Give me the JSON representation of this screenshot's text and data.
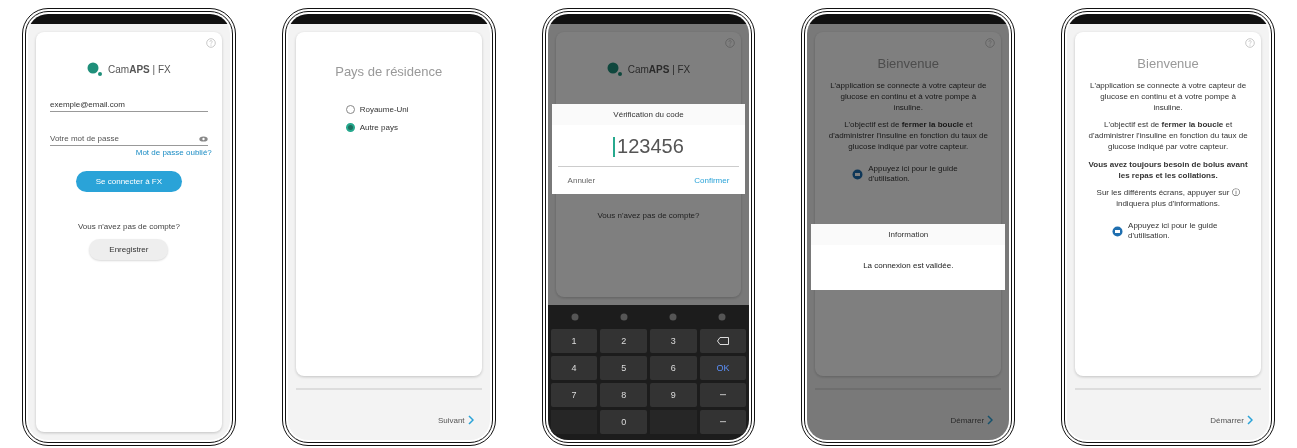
{
  "screens": [
    {
      "kind": "login",
      "logo": "Cam**APS** | FX",
      "email": {
        "value": "exemple@email.com"
      },
      "password": {
        "placeholder": "Votre mot de passe"
      },
      "forgot": "Mot de passe oublié?",
      "login_button": "Se connecter à FX",
      "no_account": "Vous n'avez pas de compte?",
      "register_button": "Enregistrer"
    },
    {
      "kind": "country",
      "title": "Pays de résidence",
      "options": [
        {
          "label": "Royaume-Uni",
          "selected": false
        },
        {
          "label": "Autre pays",
          "selected": true
        }
      ],
      "next": "Suivant"
    },
    {
      "kind": "code",
      "dimmed": true,
      "logo": "Cam**APS** | FX",
      "no_account": "Vous n'avez pas de compte?",
      "dialog": {
        "title": "Vérification du code",
        "value": "123456",
        "cancel": "Annuler",
        "confirm": "Confirmer"
      },
      "keys": [
        {
          "kind": "text",
          "label": "1"
        },
        {
          "kind": "text",
          "label": "2"
        },
        {
          "kind": "text",
          "label": "3"
        },
        {
          "kind": "backspace"
        },
        {
          "kind": "text",
          "label": "4"
        },
        {
          "kind": "text",
          "label": "5"
        },
        {
          "kind": "text",
          "label": "6"
        },
        {
          "kind": "ok",
          "label": "OK"
        },
        {
          "kind": "text",
          "label": "7"
        },
        {
          "kind": "text",
          "label": "8"
        },
        {
          "kind": "text",
          "label": "9"
        },
        {
          "kind": "symbol"
        },
        {
          "kind": "blank"
        },
        {
          "kind": "text",
          "label": "0"
        },
        {
          "kind": "blank"
        },
        {
          "kind": "symbol"
        }
      ]
    },
    {
      "kind": "welcome",
      "dimmed": true,
      "title": "Bienvenue",
      "paragraphs": [
        "L'application se connecte à votre capteur de glucose en continu et à votre pompe à insuline.",
        "L'objectif est de **fermer la boucle** et d'administrer l'insuline en fonction du taux de glucose indiqué par votre capteur."
      ],
      "guide": "Appuyez ici pour le guide d'utilisation.",
      "start": "Démarrer",
      "dialog": {
        "title": "Information",
        "message": "La connexion est validée."
      }
    },
    {
      "kind": "welcome",
      "title": "Bienvenue",
      "paragraphs": [
        "L'application se connecte à votre capteur de glucose en continu et à votre pompe à insuline.",
        "L'objectif est de **fermer la boucle** et d'administrer l'insuline en fonction du taux de glucose indiqué par votre capteur.",
        "**Vous avez toujours besoin de bolus avant les repas et les collations.**",
        "Sur les différents écrans, appuyer sur ⓘ indiquera plus d'informations."
      ],
      "guide": "Appuyez ici pour le guide d'utilisation.",
      "start": "Démarrer"
    }
  ]
}
